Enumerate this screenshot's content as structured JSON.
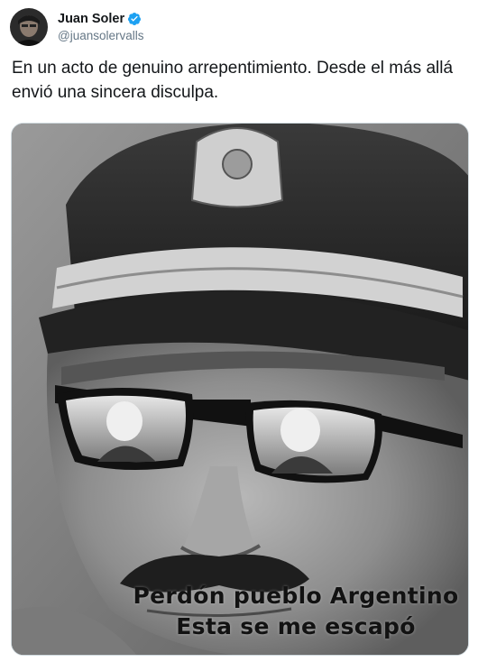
{
  "tweet": {
    "author": {
      "display_name": "Juan Soler",
      "handle": "@juansolervalls",
      "verified": true
    },
    "text": "En un acto de genuino arrepentimiento. Desde el más allá envió una sincera disculpa.",
    "media": {
      "caption_line1": "Perdón pueblo Argentino",
      "caption_line2": "Esta se me escapó"
    }
  },
  "colors": {
    "text_primary": "#14171a",
    "text_secondary": "#657786",
    "verified_badge": "#1da1f2"
  },
  "icons": [
    "verified-badge-icon"
  ]
}
